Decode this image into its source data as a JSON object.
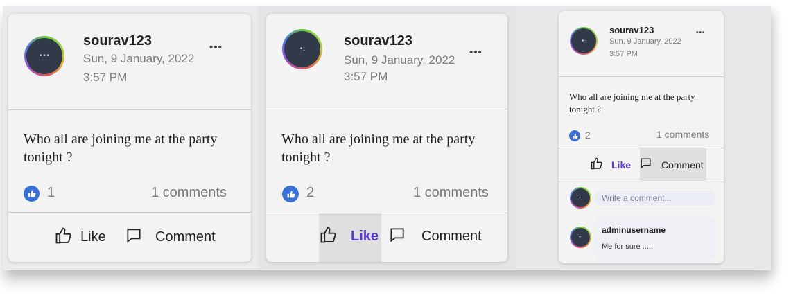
{
  "colors": {
    "accent": "#5a35d6",
    "like_blue": "#3a6fd8",
    "avatar_bg": "#323a4a"
  },
  "cards": [
    {
      "username": "sourav123",
      "date": "Sun, 9 January, 2022",
      "time": "3:57 PM",
      "more": "•••",
      "text_line1": "Who all are joining me at the party",
      "text_line2": "tonight ?",
      "likes": "1",
      "comments": "1 comments",
      "like_label": "Like",
      "comment_label": "Comment"
    },
    {
      "username": "sourav123",
      "date": "Sun, 9 January, 2022",
      "time": "3:57 PM",
      "more": "•••",
      "text_line1": "Who all are joining me at the party",
      "text_line2": "tonight ?",
      "likes": "2",
      "comments": "1 comments",
      "like_label": "Like",
      "comment_label": "Comment"
    },
    {
      "username": "sourav123",
      "date": "Sun, 9 January, 2022",
      "time": "3:57 PM",
      "more": "•••",
      "text_line1": "Who all are joining me at the party",
      "text_line2": "tonight ?",
      "likes": "2",
      "comments": "1 comments",
      "like_label": "Like",
      "comment_label": "Comment",
      "comment_placeholder": "Write a comment...",
      "reply": {
        "username": "adminusername",
        "text": "Me for sure ....."
      }
    }
  ]
}
